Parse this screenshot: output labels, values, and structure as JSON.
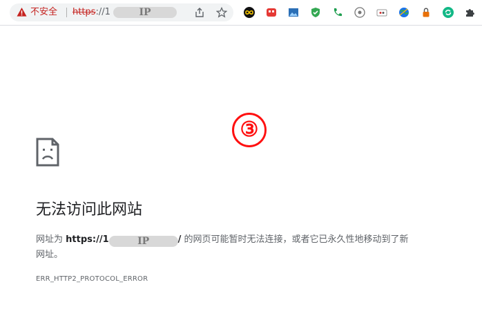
{
  "omnibox": {
    "security_label": "不安全",
    "url_scheme": "https",
    "url_rest": "://1",
    "ip_mask_label": "IP"
  },
  "annotation": {
    "number": "③"
  },
  "error": {
    "title": "无法访问此网站",
    "message_prefix": "网址为 ",
    "url_prefix": "https://1",
    "ip_mask_label": "IP",
    "url_suffix": "/",
    "message_line1_rest": " 的网页可能暂时无法连接，或者它已永久性地移动到了新",
    "message_line2": "网址。",
    "code": "ERR_HTTP2_PROTOCOL_ERROR"
  },
  "icons": {
    "warning": "warning-triangle-icon",
    "share": "share-icon",
    "bookmark": "star-icon",
    "extensions": [
      "infinity-icon",
      "red-extension-icon",
      "image-extension-icon",
      "shield-icon",
      "phone-icon",
      "settings-icon",
      "card-icon",
      "globe-icon",
      "lock-icon",
      "refresh-icon",
      "puzzle-icon"
    ]
  },
  "colors": {
    "insecure": "#c5221f",
    "annotation": "#ff1010"
  }
}
